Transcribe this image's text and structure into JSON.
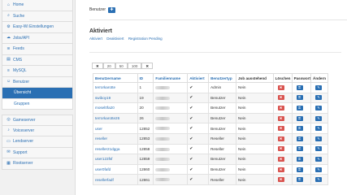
{
  "sidebar": {
    "items": [
      {
        "label": "Home",
        "icon": "home-icon",
        "glyph": "⌂"
      },
      {
        "label": "Suche",
        "icon": "search-icon",
        "glyph": "⌕"
      },
      {
        "label": "Easy-Wi Einstellungen",
        "icon": "gear-icon",
        "glyph": "⚙"
      },
      {
        "label": "Jobs/API",
        "icon": "cloud-icon",
        "glyph": "☁"
      },
      {
        "label": "Feeds",
        "icon": "rss-icon",
        "glyph": "≋"
      },
      {
        "label": "CMS",
        "icon": "cms-icon",
        "glyph": "▤"
      },
      {
        "label": "MySQL",
        "icon": "database-icon",
        "glyph": "≡"
      },
      {
        "label": "Benutzer",
        "icon": "user-icon",
        "glyph": "☺"
      }
    ],
    "subitems": [
      {
        "label": "Übersicht"
      },
      {
        "label": "Gruppen"
      }
    ],
    "items2": [
      {
        "label": "Gameserver",
        "icon": "gamepad-icon",
        "glyph": "◎"
      },
      {
        "label": "Voiceserver",
        "icon": "microphone-icon",
        "glyph": "♪"
      },
      {
        "label": "Lendserver",
        "icon": "server-icon",
        "glyph": "▭"
      },
      {
        "label": "Support",
        "icon": "support-icon",
        "glyph": "✉"
      },
      {
        "label": "Rootserver",
        "icon": "rootserver-icon",
        "glyph": "▦"
      }
    ]
  },
  "header": {
    "label": "Benutzer",
    "add_glyph": "✚"
  },
  "section": {
    "title": "Aktiviert",
    "filters": [
      "Aktiviert",
      "Deaktiviert",
      "Registration Pending"
    ]
  },
  "pager": [
    "✖",
    "20",
    "50",
    "100",
    "✖"
  ],
  "table": {
    "columns": [
      "Benutzername",
      "ID",
      "Familienname",
      "Aktiviert",
      "Benutzertyp",
      "Job ausstehend",
      "Löschen",
      "Passwort",
      "Ändern"
    ],
    "rows": [
      {
        "user": "terrorkarotte",
        "id": "1",
        "name": "",
        "active": "✔",
        "type": "Admin",
        "job": "Nein"
      },
      {
        "user": "swiboy19",
        "id": "19",
        "name": "",
        "active": "✔",
        "type": "Benutzer",
        "job": "Nein"
      },
      {
        "user": "mosel0fa20",
        "id": "20",
        "name": "",
        "active": "✔",
        "type": "Benutzer",
        "job": "Nein"
      },
      {
        "user": "terrorkarotte26",
        "id": "26",
        "name": "",
        "active": "✔",
        "type": "Benutzer",
        "job": "Nein"
      },
      {
        "user": "user",
        "id": "12852",
        "name": "",
        "active": "✔",
        "type": "Benutzer",
        "job": "Nein"
      },
      {
        "user": "reseller",
        "id": "12853",
        "name": "",
        "active": "✔",
        "type": "Reseller",
        "job": "Nein"
      },
      {
        "user": "reseller21dgga",
        "id": "12858",
        "name": "",
        "active": "✔",
        "type": "Reseller",
        "job": "Nein"
      },
      {
        "user": "user123fsf",
        "id": "12859",
        "name": "",
        "active": "✔",
        "type": "Benutzer",
        "job": "Nein"
      },
      {
        "user": "user0fafd",
        "id": "12860",
        "name": "",
        "active": "✔",
        "type": "Benutzer",
        "job": "Nein"
      },
      {
        "user": "resellerfadf",
        "id": "12861",
        "name": "",
        "active": "✔",
        "type": "Reseller",
        "job": "Nein"
      }
    ]
  }
}
